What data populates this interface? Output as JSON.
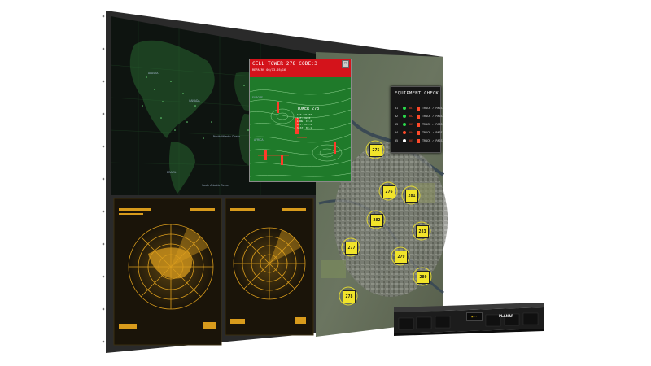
{
  "cell_popup": {
    "title": "CELL TOWER 278 CODE:3",
    "subtitle": "REPAIRS 06/13-05/16",
    "close_glyph": "×",
    "tower_label": "TOWER 278",
    "tower_details": "SIT 221.02\nLAT: 32.0\nLONG: 19.2\nALT: 170.9\nSTAT: 69.1"
  },
  "equipment_check": {
    "title": "EQUIPMENT CHECK",
    "rows": [
      {
        "id": "01",
        "value": "001",
        "text": "TRACK ✓ PASS",
        "dot": "#2bd94a"
      },
      {
        "id": "02",
        "value": "002",
        "text": "TRACK ✓ PASS",
        "dot": "#2bd94a"
      },
      {
        "id": "03",
        "value": "003",
        "text": "TRACK ✓ PASS",
        "dot": "#2bd94a"
      },
      {
        "id": "04",
        "value": "004",
        "text": "TRACK ✓ PASS",
        "dot": "#ff4a2a"
      },
      {
        "id": "05",
        "value": "005",
        "text": "TRACK ✓ PASS",
        "dot": "#ffffff"
      }
    ]
  },
  "map_towers": [
    "275",
    "276",
    "281",
    "282",
    "277",
    "283",
    "279",
    "278",
    "280"
  ],
  "world_map_labels": [
    "ALASKA",
    "CANADA",
    "BRAZIL",
    "South Atlantic Ocean",
    "EUROPE",
    "AFRICA",
    "North Atlantic Ocean"
  ],
  "device": {
    "brand": "PLANAR",
    "lcd": "▣ ··"
  },
  "colors": {
    "alert_red": "#d4131b",
    "terrain_green": "#1f7a2a",
    "radar_amber": "#d89b1c",
    "tower_yellow": "#f1e42a",
    "world_map_green": "#3fa84a"
  }
}
